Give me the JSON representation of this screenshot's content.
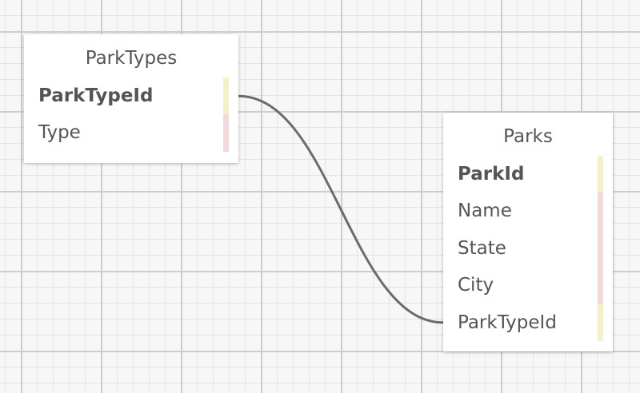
{
  "colors": {
    "key_marker": "#f2f2c4",
    "attribute_marker": "#f6d8d8",
    "connector": "#6b6b6b"
  },
  "tables": [
    {
      "id": "parktypes",
      "name": "ParkTypes",
      "fields": [
        {
          "name": "ParkTypeId",
          "primary_key": true,
          "key": true
        },
        {
          "name": "Type",
          "primary_key": false,
          "key": false
        }
      ]
    },
    {
      "id": "parks",
      "name": "Parks",
      "fields": [
        {
          "name": "ParkId",
          "primary_key": true,
          "key": true
        },
        {
          "name": "Name",
          "primary_key": false,
          "key": false
        },
        {
          "name": "State",
          "primary_key": false,
          "key": false
        },
        {
          "name": "City",
          "primary_key": false,
          "key": false
        },
        {
          "name": "ParkTypeId",
          "primary_key": false,
          "key": true
        }
      ]
    }
  ],
  "relationships": [
    {
      "from_table": "parktypes",
      "from_field": "ParkTypeId",
      "to_table": "parks",
      "to_field": "ParkTypeId"
    }
  ]
}
